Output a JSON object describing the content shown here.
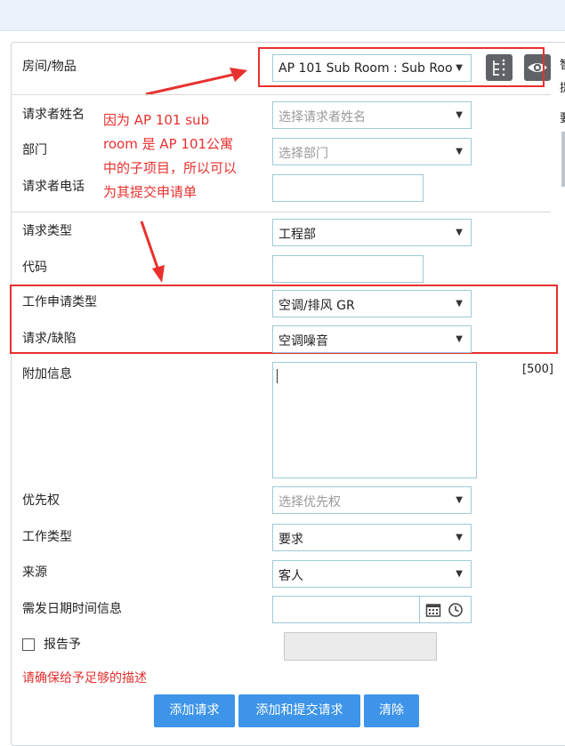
{
  "form": {
    "room_label": "房间/物品",
    "room_value": "AP 101 Sub Room : Sub Roo",
    "requester_name_label": "请求者姓名",
    "requester_name_placeholder": "选择请求者姓名",
    "department_label": "部门",
    "department_placeholder": "选择部门",
    "requester_phone_label": "请求者电话",
    "request_type_label": "请求类型",
    "request_type_value": "工程部",
    "code_label": "代码",
    "work_request_type_label": "工作申请类型",
    "work_request_type_value": "空调/排风 GR",
    "request_defect_label": "请求/缺陷",
    "request_defect_value": "空调噪音",
    "additional_info_label": "附加信息",
    "char_limit": "[500]",
    "priority_label": "优先权",
    "priority_placeholder": "选择优先权",
    "work_type_label": "工作类型",
    "work_type_value": "要求",
    "source_label": "来源",
    "source_value": "客人",
    "due_datetime_label": "需发日期时间信息",
    "report_to_label": "报告予",
    "warning": "请确保给予足够的描述"
  },
  "annotation": {
    "lines": [
      "因为 AP 101 sub",
      "room 是 AP 101公寓",
      "中的子项目，所以可以",
      "为其提交申请单"
    ]
  },
  "buttons": {
    "add_request": "添加请求",
    "add_submit_request": "添加和提交请求",
    "clear": "清除"
  },
  "sidebar_chars": [
    "智",
    "提",
    "要"
  ],
  "colors": {
    "accent": "#3d94e8",
    "annotation_red": "#e8312f",
    "field_border": "#9ecbd8",
    "icon_button": "#5f6367"
  },
  "icons": [
    "tree-hierarchy-icon",
    "eye-icon",
    "calendar-icon",
    "clock-icon",
    "dropdown-arrow-icon"
  ]
}
